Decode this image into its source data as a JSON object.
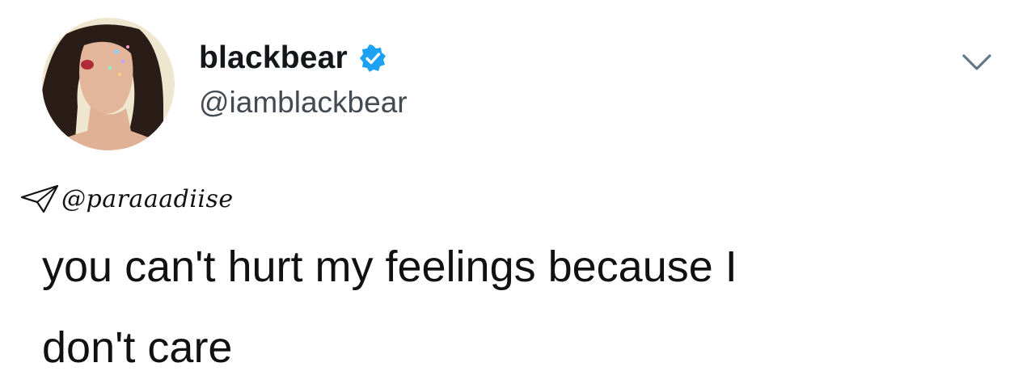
{
  "tweet": {
    "author": {
      "display_name": "blackbear",
      "handle": "@iamblackbear",
      "verified": true
    },
    "text_lines": [
      "you can't hurt my feelings because I",
      "don't care"
    ],
    "watermark": "@paraaadiise"
  },
  "icons": {
    "verified": "verified-badge-icon",
    "menu": "chevron-down-icon",
    "watermark": "paper-plane-icon"
  },
  "colors": {
    "verified_badge": "#1da1f2",
    "name_text": "#14171a",
    "handle_text": "#434a51",
    "body_text": "#111111"
  }
}
